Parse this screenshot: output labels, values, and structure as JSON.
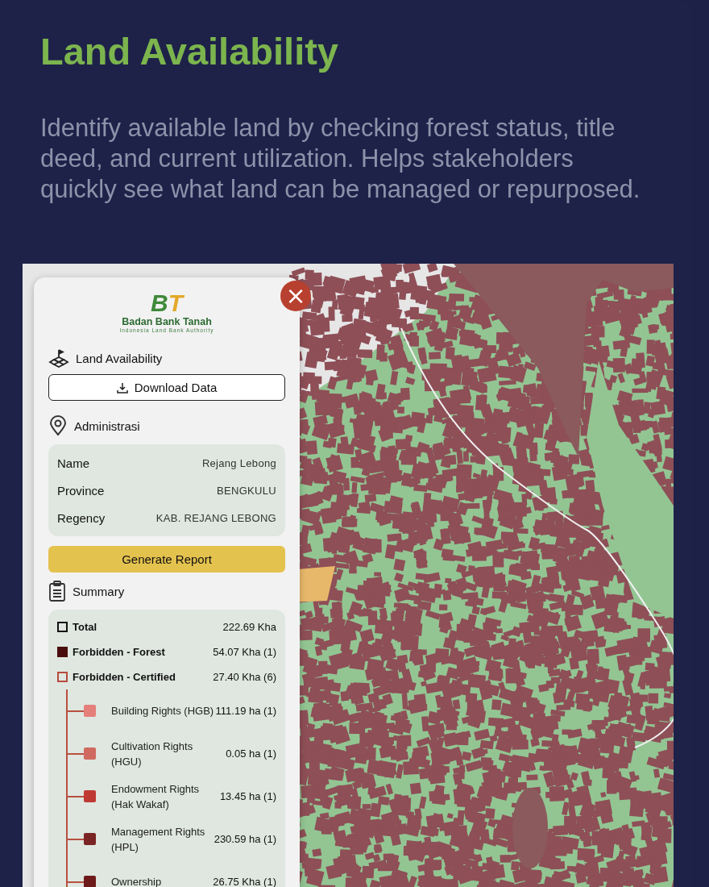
{
  "header": {
    "title": "Land Availability",
    "description": "Identify available land by checking forest status, title deed, and current utilization. Helps stakeholders quickly see what land can be managed or repurposed."
  },
  "panel": {
    "close_label": "×",
    "logo": {
      "mark_left": "B",
      "mark_right": "T",
      "name": "Badan Bank Tanah",
      "tagline": "Indonesia Land Bank Authority"
    },
    "layer_title": "Land Availability",
    "download_button": "Download Data",
    "admin_title": "Administrasi",
    "admin_rows": [
      {
        "label": "Name",
        "value": "Rejang Lebong"
      },
      {
        "label": "Province",
        "value": "BENGKULU"
      },
      {
        "label": "Regency",
        "value": "KAB. REJANG LEBONG"
      }
    ],
    "report_button": "Generate Report",
    "summary_title": "Summary",
    "summary": [
      {
        "label": "Total",
        "value": "222.69 Kha",
        "kind": "outline",
        "color": "#111111"
      },
      {
        "label": "Forbidden - Forest",
        "value": "54.07 Kha (1)",
        "kind": "filled",
        "color": "#4a0d0d"
      },
      {
        "label": "Forbidden - Certified",
        "value": "27.40 Kha (6)",
        "kind": "outline",
        "color": "#b84a3c",
        "expanded": true,
        "children": [
          {
            "label": "Building Rights (HGB)",
            "value": "111.19 ha (1)",
            "color": "#e57f7a"
          },
          {
            "label": "Cultivation Rights (HGU)",
            "value": "0.05 ha (1)",
            "color": "#d06a60"
          },
          {
            "label": "Endowment Rights (Hak Wakaf)",
            "value": "13.45 ha (1)",
            "color": "#bf3a33"
          },
          {
            "label": "Management Rights (HPL)",
            "value": "230.59 ha (1)",
            "color": "#7a2424"
          },
          {
            "label": "Ownership",
            "value": "26.75 Kha (1)",
            "color": "#6e1a1a"
          }
        ]
      }
    ]
  }
}
